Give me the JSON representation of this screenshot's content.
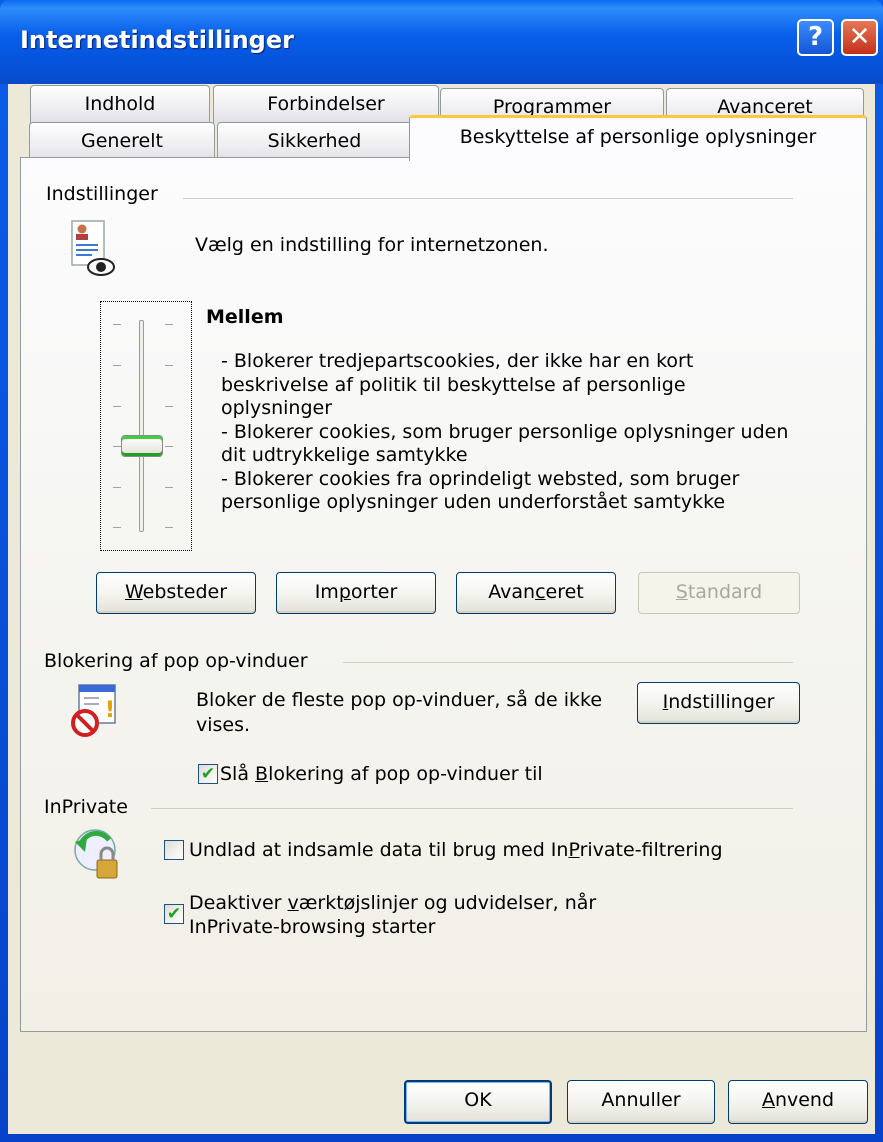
{
  "window": {
    "title": "Internetindstillinger",
    "help_label": "?",
    "close_label": "✕"
  },
  "tabs": {
    "row1": [
      "Indhold",
      "Forbindelser",
      "Programmer",
      "Avanceret"
    ],
    "row2": [
      "Generelt",
      "Sikkerhed",
      "Beskyttelse af personlige oplysninger"
    ],
    "active": "Beskyttelse af personlige oplysninger"
  },
  "settings": {
    "group_label": "Indstillinger",
    "zone_text": "Vælg en indstilling for internetzonen.",
    "level_title": "Mellem",
    "level_description": [
      "- Blokerer tredjepartscookies, der ikke har en kort",
      "beskrivelse af politik til beskyttelse af personlige",
      "oplysninger",
      "- Blokerer cookies, som bruger personlige oplysninger uden",
      "dit udtrykkelige samtykke",
      "- Blokerer cookies fra oprindeligt websted, som bruger",
      "personlige oplysninger uden underforstået samtykke"
    ],
    "slider_level": 3,
    "slider_levels_total": 6,
    "buttons": {
      "sites": {
        "pre": "",
        "key": "W",
        "post": "ebsteder"
      },
      "import": {
        "pre": "Im",
        "key": "p",
        "post": "orter"
      },
      "advanced": {
        "pre": "Avan",
        "key": "c",
        "post": "eret"
      },
      "default": {
        "pre": "",
        "key": "S",
        "post": "tandard"
      }
    }
  },
  "popup": {
    "group_label": "Blokering af pop op-vinduer",
    "description_line1": "Bloker de fleste pop op-vinduer, så de ikke",
    "description_line2": "vises.",
    "settings_button": {
      "pre": "",
      "key": "I",
      "post": "ndstillinger"
    },
    "checkbox": {
      "pre": "Slå ",
      "key": "B",
      "post": "lokering af pop op-vinduer til",
      "checked": true
    }
  },
  "inprivate": {
    "group_label": "InPrivate",
    "checkbox1": {
      "pre": "Undlad at indsamle data til brug med In",
      "key": "P",
      "post": "rivate-filtrering",
      "checked": false
    },
    "checkbox2": {
      "pre": "Deaktiver ",
      "key": "v",
      "post": "ærktøjslinjer og udvidelser, når",
      "line2": "InPrivate-browsing starter",
      "checked": true
    }
  },
  "footer": {
    "ok": "OK",
    "cancel": "Annuller",
    "apply": {
      "pre": "",
      "key": "A",
      "post": "nvend"
    }
  },
  "colors": {
    "titlebar": "#0a5ee8",
    "active_tab_highlight": "#ffc83c",
    "check_green": "#21a121",
    "dialog_bg": "#ece9d8"
  }
}
